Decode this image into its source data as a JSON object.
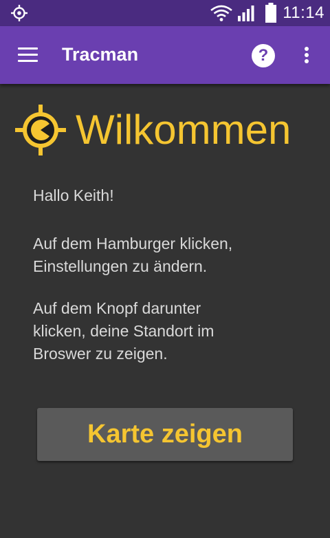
{
  "status_bar": {
    "time": "11:14",
    "icons": [
      "location-target-icon",
      "wifi-icon",
      "signal-icon",
      "battery-icon"
    ]
  },
  "app_bar": {
    "title": "Tracman",
    "help_label": "?",
    "icons": [
      "hamburger-menu-icon",
      "help-icon",
      "more-vert-icon"
    ]
  },
  "main": {
    "welcome_title": "Wilkommen",
    "paragraphs": [
      [
        "Hallo Keith!"
      ],
      [
        "Auf dem Hamburger klicken,",
        "Einstellungen zu ändern."
      ],
      [
        "Auf dem Knopf darunter",
        "klicken, deine Standort im",
        "Broswer zu zeigen."
      ]
    ],
    "button_label": "Karte zeigen"
  },
  "colors": {
    "status_bar": "#4a2b80",
    "app_bar": "#6a3fb0",
    "background": "#333333",
    "accent_yellow": "#f5c531",
    "body_text": "#d9d9d9",
    "button_bg": "#5a5a5a"
  }
}
